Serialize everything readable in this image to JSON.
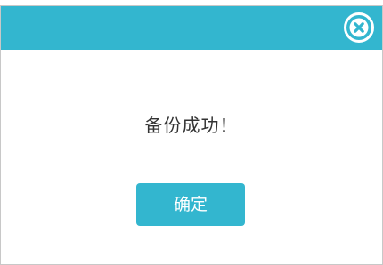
{
  "dialog": {
    "message": "备份成功！",
    "ok_label": "确定",
    "close_icon": "close-icon",
    "colors": {
      "accent": "#33b6cf",
      "text": "#333333",
      "border": "#c8c8c8"
    }
  }
}
